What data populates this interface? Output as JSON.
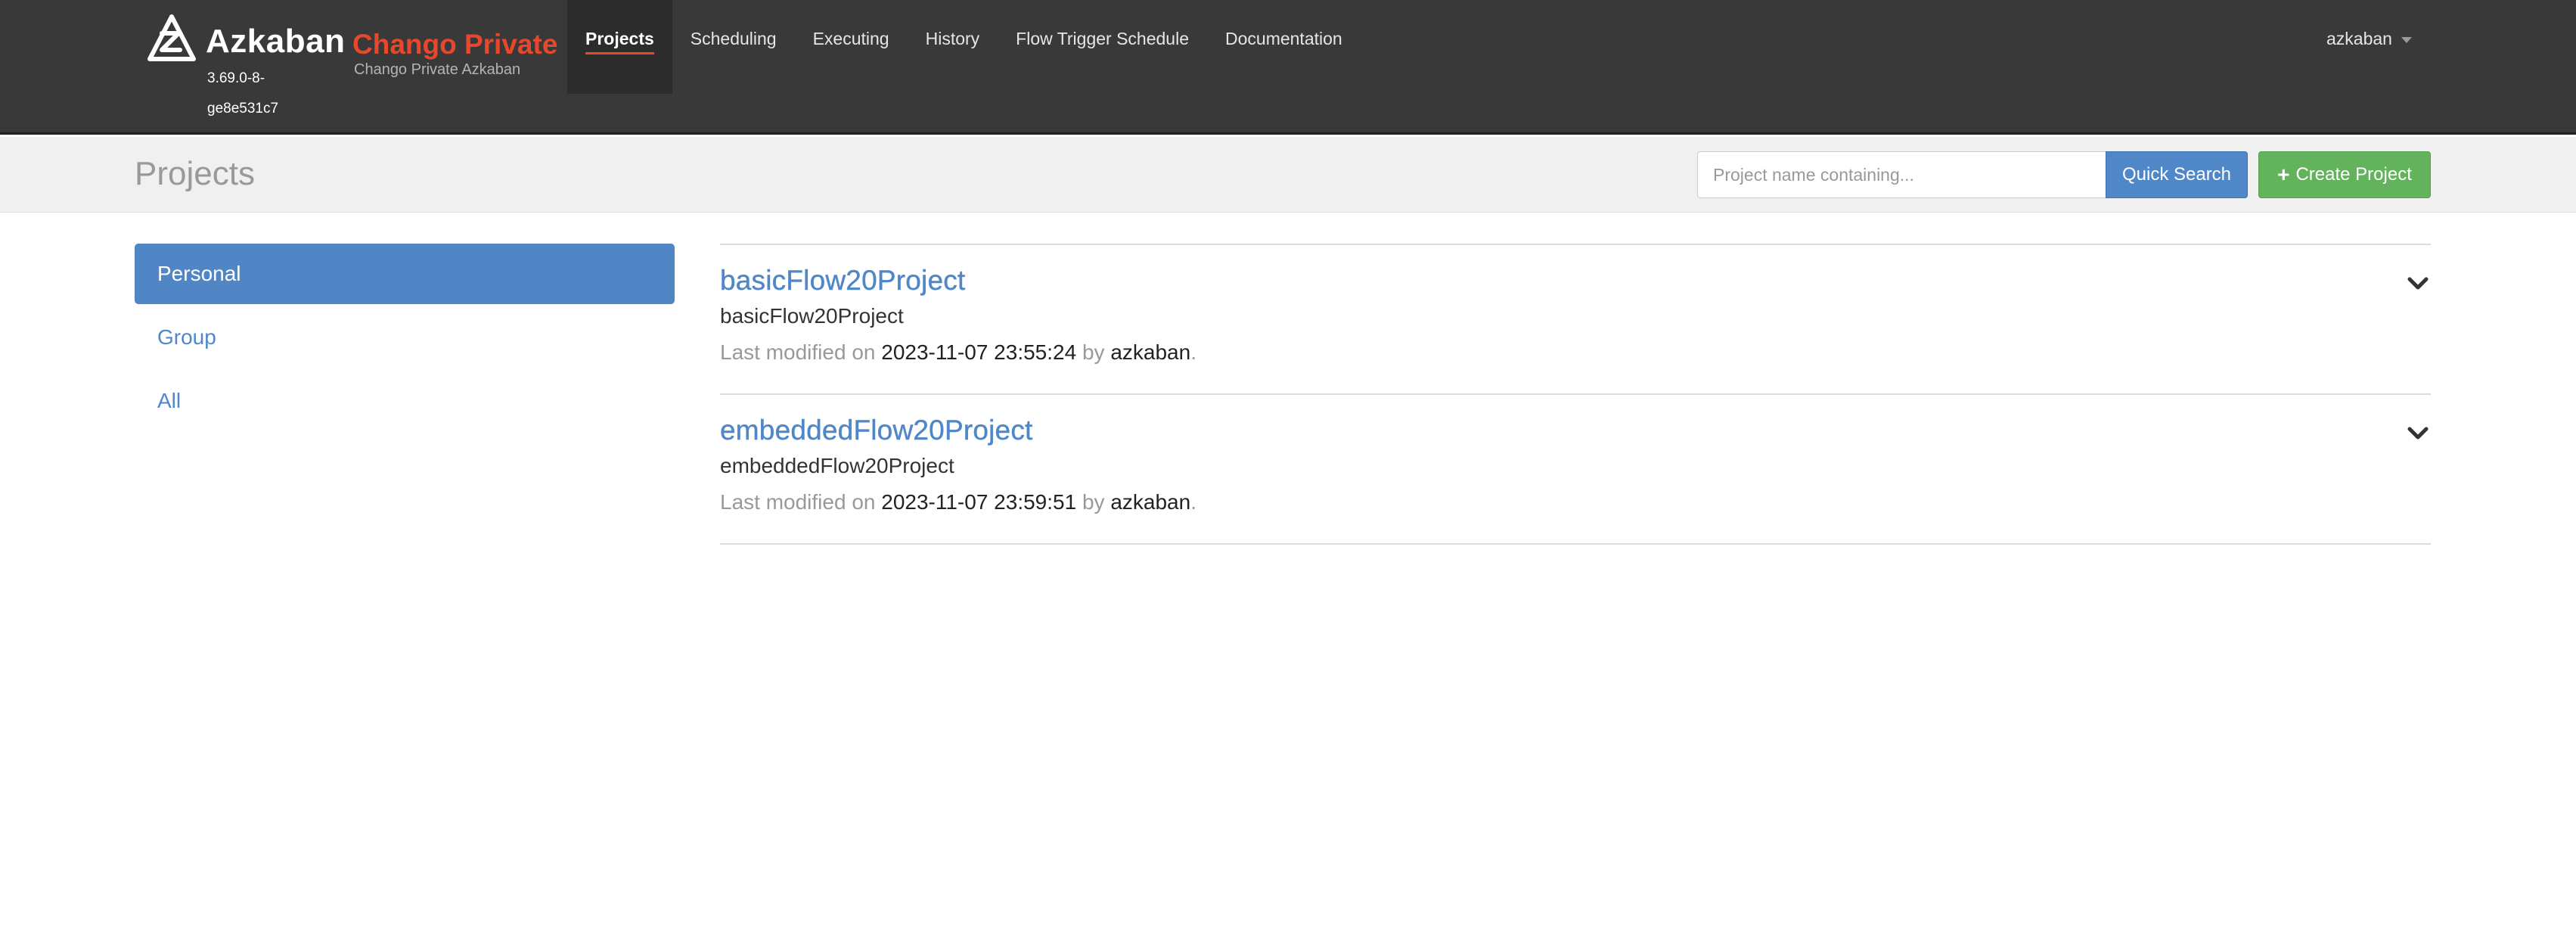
{
  "brand": {
    "name": "Azkaban",
    "version": "3.69.0-8-ge8e531c7",
    "env_name": "Chango Private",
    "env_subtitle": "Chango Private Azkaban"
  },
  "nav": {
    "items": [
      {
        "label": "Projects",
        "active": true
      },
      {
        "label": "Scheduling"
      },
      {
        "label": "Executing"
      },
      {
        "label": "History"
      },
      {
        "label": "Flow Trigger Schedule"
      },
      {
        "label": "Documentation"
      }
    ],
    "user": "azkaban"
  },
  "header": {
    "title": "Projects",
    "search_placeholder": "Project name containing...",
    "quick_search_label": "Quick Search",
    "create_project_label": "Create Project"
  },
  "sidebar": {
    "items": [
      {
        "label": "Personal",
        "active": true
      },
      {
        "label": "Group"
      },
      {
        "label": "All"
      }
    ]
  },
  "projects": [
    {
      "name": "basicFlow20Project",
      "description": "basicFlow20Project",
      "modified_prefix": "Last modified on",
      "modified_date": "2023-11-07 23:55:24",
      "by_label": "by",
      "user": "azkaban",
      "suffix": "."
    },
    {
      "name": "embeddedFlow20Project",
      "description": "embeddedFlow20Project",
      "modified_prefix": "Last modified on",
      "modified_date": "2023-11-07 23:59:51",
      "by_label": "by",
      "user": "azkaban",
      "suffix": "."
    }
  ],
  "colors": {
    "navbar": "#393939",
    "accent_red": "#e8472b",
    "link_blue": "#4f87c8",
    "success_green": "#62b35c"
  },
  "icons": {
    "logo": "azkaban-logo-icon",
    "expand": "chevron-down-icon",
    "plus": "plus-icon",
    "user_caret": "caret-down-icon"
  }
}
